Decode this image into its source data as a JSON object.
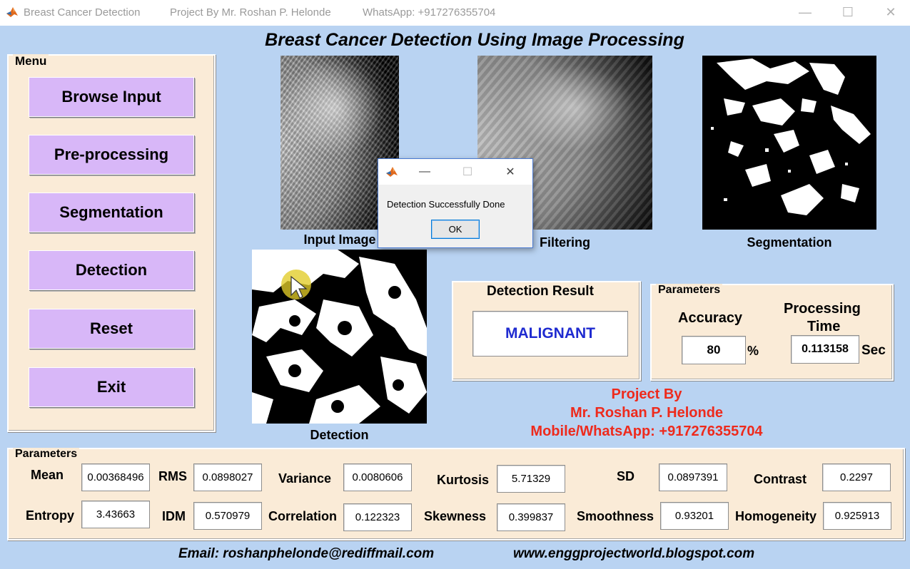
{
  "window": {
    "title": "Breast Cancer Detection",
    "author_text": "Project By Mr. Roshan P. Helonde",
    "whatsapp_text": "WhatsApp: +917276355704",
    "minimize_glyph": "—",
    "maximize_glyph": "☐",
    "close_glyph": "✕"
  },
  "header": {
    "title": "Breast Cancer Detection Using Image Processing"
  },
  "menu": {
    "title": "Menu",
    "buttons": [
      "Browse Input",
      "Pre-processing",
      "Segmentation",
      "Detection",
      "Reset",
      "Exit"
    ]
  },
  "images": {
    "input": "Input Image",
    "filtering": "Filtering",
    "segmentation": "Segmentation",
    "detection": "Detection"
  },
  "dialog": {
    "message": "Detection Successfully Done",
    "ok_label": "OK",
    "minimize_glyph": "—",
    "maximize_glyph": "☐",
    "close_glyph": "✕"
  },
  "result": {
    "title": "Detection Result",
    "value": "MALIGNANT",
    "value_color": "#1f2bd0"
  },
  "params_top": {
    "title": "Parameters",
    "accuracy_label": "Accuracy",
    "accuracy_value": "80",
    "accuracy_unit": "%",
    "time_label_1": "Processing",
    "time_label_2": "Time",
    "time_value": "0.113158",
    "time_unit": "Sec"
  },
  "credits": {
    "line1": "Project By",
    "line2": "Mr. Roshan P. Helonde",
    "line3": "Mobile/WhatsApp: +917276355704",
    "color": "#ee2a1c"
  },
  "params_bottom": {
    "title": "Parameters",
    "mean_label": "Mean",
    "mean": "0.00368496",
    "rms_label": "RMS",
    "rms": "0.0898027",
    "variance_label": "Variance",
    "variance": "0.0080606",
    "kurtosis_label": "Kurtosis",
    "kurtosis": "5.71329",
    "sd_label": "SD",
    "sd": "0.0897391",
    "contrast_label": "Contrast",
    "contrast": "0.2297",
    "entropy_label": "Entropy",
    "entropy": "3.43663",
    "idm_label": "IDM",
    "idm": "0.570979",
    "correlation_label": "Correlation",
    "correlation": "0.122323",
    "skewness_label": "Skewness",
    "skewness": "0.399837",
    "smoothness_label": "Smoothness",
    "smoothness": "0.93201",
    "homogeneity_label": "Homogeneity",
    "homogeneity": "0.925913"
  },
  "footer": {
    "email": "Email: roshanphelonde@rediffmail.com",
    "website": "www.enggprojectworld.blogspot.com"
  }
}
